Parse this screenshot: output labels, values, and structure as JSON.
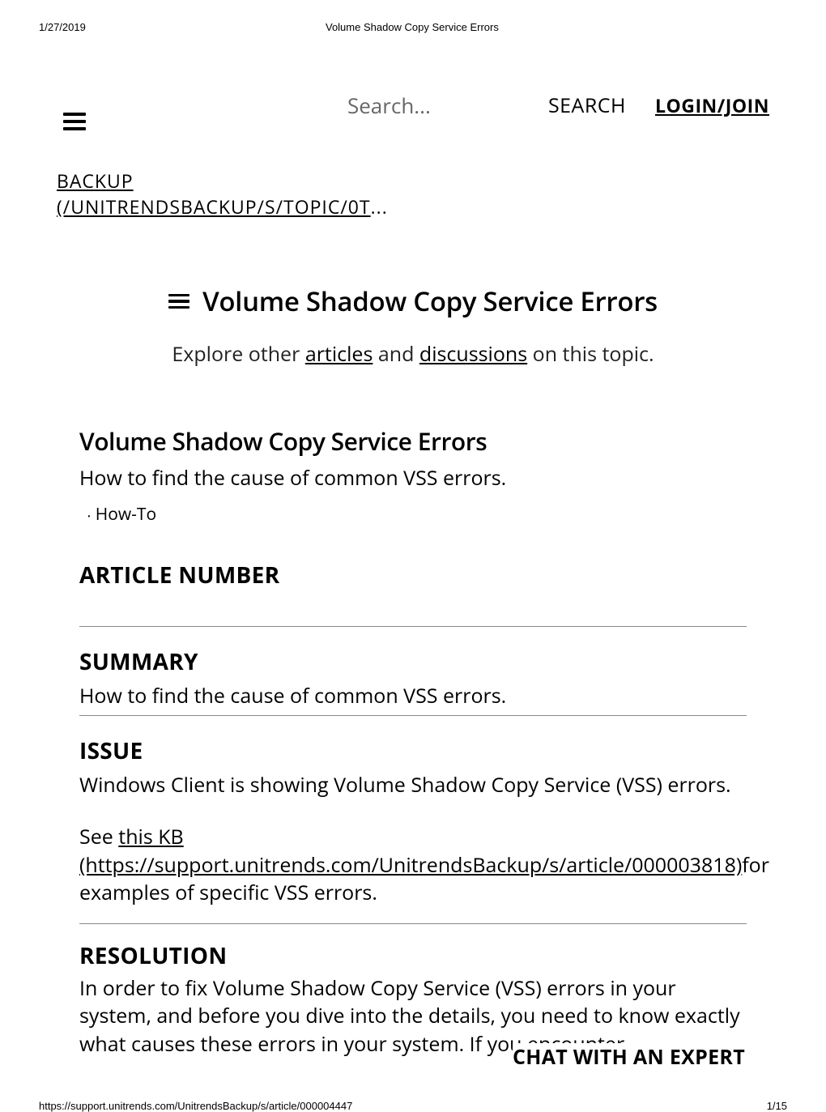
{
  "print": {
    "date": "1/27/2019",
    "title": "Volume Shadow Copy Service Errors",
    "url": "https://support.unitrends.com/UnitrendsBackup/s/article/000004447",
    "page": "1/15"
  },
  "header": {
    "search_placeholder": "Search...",
    "search_button": "SEARCH",
    "login_label": "LOGIN/JOIN"
  },
  "breadcrumb": {
    "line1": "BACKUP",
    "line2a": "(/UNITRENDSBACKUP/S/TOPIC/0T",
    "trail": "..."
  },
  "article": {
    "title": "Volume Shadow Copy Service Errors",
    "explore_prefix": "Explore other ",
    "explore_link1": "articles",
    "explore_mid": " and ",
    "explore_link2": "discussions",
    "explore_suffix": " on this topic.",
    "subtitle": "Volume Shadow Copy Service Errors",
    "desc": "How to find the cause of common VSS errors.",
    "tag": "How-To"
  },
  "sections": {
    "article_number_heading": "ARTICLE NUMBER",
    "summary_heading": "SUMMARY",
    "summary_text": "How to find the cause of common VSS errors.",
    "issue_heading": "ISSUE",
    "issue_text": "Windows Client is showing Volume Shadow Copy Service (VSS) errors.",
    "issue_see_prefix": "See ",
    "issue_kb_link_l1": "this KB",
    "issue_kb_link_l2": "(https://support.unitrends.com/UnitrendsBackup/s/article/000003818)",
    "issue_see_suffix": "for examples of specific VSS errors.",
    "resolution_heading": "RESOLUTION",
    "resolution_text": "In order to fix Volume Shadow Copy Service (VSS) errors in your system, and before you dive into the details,  you need to know exactly what causes these errors in your system. If you encounter"
  },
  "chat": {
    "label": "CHAT WITH AN EXPERT"
  }
}
